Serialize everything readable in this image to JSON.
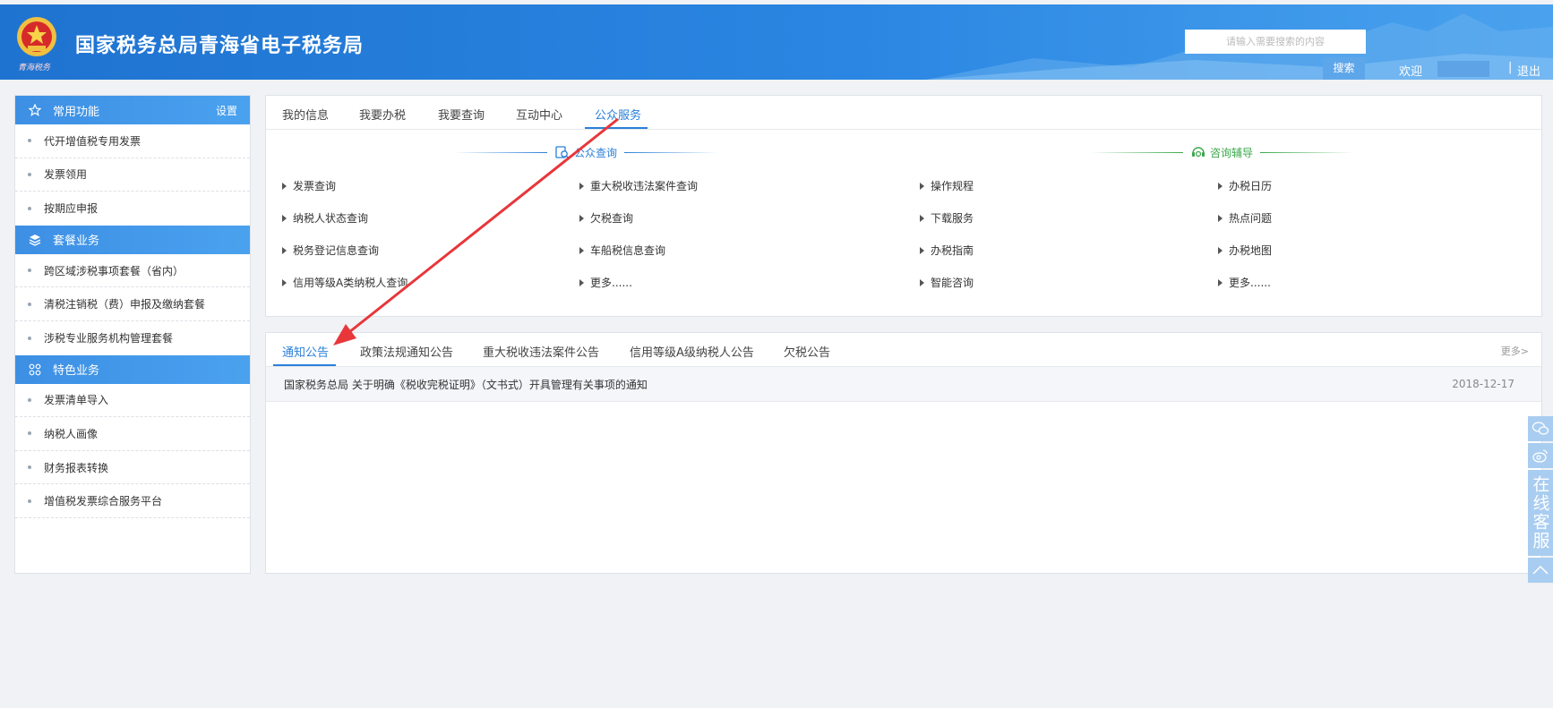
{
  "header": {
    "emblem_text": "青海税务",
    "title": "国家税务总局青海省电子税务局",
    "search_placeholder": "请输入需要搜索的内容",
    "search_button": "搜索",
    "welcome": "欢迎",
    "separator": "|",
    "logout": "退出"
  },
  "sidebar": {
    "sections": [
      {
        "title": "常用功能",
        "icon": "star-icon",
        "extra": "设置",
        "items": [
          "代开增值税专用发票",
          "发票领用",
          "按期应申报"
        ]
      },
      {
        "title": "套餐业务",
        "icon": "layers-icon",
        "extra": "",
        "items": [
          "跨区域涉税事项套餐（省内）",
          "清税注销税（费）申报及缴纳套餐",
          "涉税专业服务机构管理套餐"
        ]
      },
      {
        "title": "特色业务",
        "icon": "grid-icon",
        "extra": "",
        "items": [
          "发票清单导入",
          "纳税人画像",
          "财务报表转换",
          "增值税发票综合服务平台"
        ]
      }
    ]
  },
  "top_tabs": [
    "我的信息",
    "我要办税",
    "我要查询",
    "互动中心",
    "公众服务"
  ],
  "active_top_tab": "公众服务",
  "public_query": {
    "title": "公众查询",
    "columns": [
      [
        "发票查询",
        "纳税人状态查询",
        "税务登记信息查询",
        "信用等级A类纳税人查询"
      ],
      [
        "重大税收违法案件查询",
        "欠税查询",
        "车船税信息查询",
        "更多......"
      ]
    ]
  },
  "consult_guide": {
    "title": "咨询辅导",
    "columns": [
      [
        "操作规程",
        "下载服务",
        "办税指南",
        "智能咨询"
      ],
      [
        "办税日历",
        "热点问题",
        "办税地图",
        "更多......"
      ]
    ]
  },
  "notice_tabs": [
    "通知公告",
    "政策法规通知公告",
    "重大税收违法案件公告",
    "信用等级A级纳税人公告",
    "欠税公告"
  ],
  "notice_more": "更多>",
  "notices": [
    {
      "title": "国家税务总局 关于明确《税收完税证明》（文书式）开具管理有关事项的通知",
      "date": "2018-12-17"
    }
  ],
  "float_bar": {
    "service_text": "在线客服"
  },
  "colors": {
    "primary": "#2a7fd8",
    "green": "#3aa84a",
    "arrow": "#e8363a"
  }
}
